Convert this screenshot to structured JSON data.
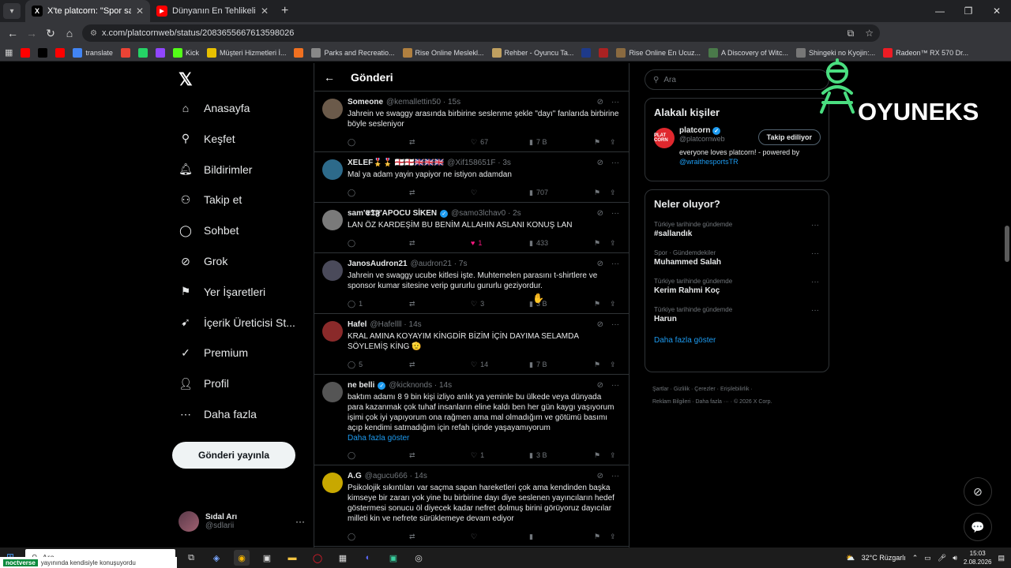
{
  "browser": {
    "tabs": [
      {
        "title": "X'te platcorn: \"Spor salonunda",
        "favicon": "X",
        "active": true
      },
      {
        "title": "Dünyanın En Tehlikeli Deniz Ca",
        "favicon": "▶",
        "active": false
      }
    ],
    "url": "x.com/platcornweb/status/2083655667613598026",
    "bookmarks": [
      {
        "label": "",
        "icon": "youtube-icon",
        "color": "#ff0000"
      },
      {
        "label": "",
        "icon": "x-icon",
        "color": "#000000"
      },
      {
        "label": "",
        "icon": "youtube-icon",
        "color": "#ff0000"
      },
      {
        "label": "translate",
        "icon": "google-icon",
        "color": "#4285f4"
      },
      {
        "label": "",
        "icon": "gmail-icon",
        "color": "#ea4335"
      },
      {
        "label": "",
        "icon": "whatsapp-icon",
        "color": "#25d366"
      },
      {
        "label": "",
        "icon": "twitch-icon",
        "color": "#9146ff"
      },
      {
        "label": "Kick",
        "icon": "kick-icon",
        "color": "#53fc18"
      },
      {
        "label": "Müşteri Hizmetleri İ...",
        "icon": "s-icon",
        "color": "#e8c000"
      },
      {
        "label": "",
        "icon": "k-icon",
        "color": "#f07020"
      },
      {
        "label": "Parks and Recreatio...",
        "icon": "bookmark-icon",
        "color": "#888888"
      },
      {
        "label": "Rise Online Meslekl...",
        "icon": "rise-icon",
        "color": "#b08040"
      },
      {
        "label": "Rehber - Oyuncu Ta...",
        "icon": "r-icon",
        "color": "#c0a060"
      },
      {
        "label": "",
        "icon": "b-icon",
        "color": "#1e3a8a"
      },
      {
        "label": "",
        "icon": "bookmark-icon",
        "color": "#aa2222"
      },
      {
        "label": "Rise Online En Ucuz...",
        "icon": "rise-icon",
        "color": "#8a6a40"
      },
      {
        "label": "A Discovery of Witc...",
        "icon": "witch-icon",
        "color": "#4a7a4a"
      },
      {
        "label": "Shingeki no Kyojin:...",
        "icon": "snk-icon",
        "color": "#777777"
      },
      {
        "label": "Radeon™ RX 570 Dr...",
        "icon": "radeon-icon",
        "color": "#ed1c24"
      }
    ]
  },
  "nav": {
    "items": [
      {
        "label": "Anasayfa",
        "icon": "home-icon",
        "name": "home"
      },
      {
        "label": "Keşfet",
        "icon": "search-icon",
        "name": "explore"
      },
      {
        "label": "Bildirimler",
        "icon": "bell-icon",
        "name": "notifications"
      },
      {
        "label": "Takip et",
        "icon": "add-person-icon",
        "name": "follow"
      },
      {
        "label": "Sohbet",
        "icon": "chat-icon",
        "name": "chat"
      },
      {
        "label": "Grok",
        "icon": "grok-icon",
        "name": "grok"
      },
      {
        "label": "Yer İşaretleri",
        "icon": "bookmark-icon",
        "name": "bookmarks"
      },
      {
        "label": "İçerik Üreticisi St...",
        "icon": "rocket-icon",
        "name": "creator-studio"
      },
      {
        "label": "Premium",
        "icon": "check-badge-icon",
        "name": "premium"
      },
      {
        "label": "Profil",
        "icon": "person-icon",
        "name": "profile"
      },
      {
        "label": "Daha fazla",
        "icon": "more-circle-icon",
        "name": "more"
      }
    ],
    "post_button": "Gönderi yayınla",
    "user": {
      "name": "Sıdal Arı",
      "handle": "@sdlarii"
    }
  },
  "feed": {
    "title": "Gönderi",
    "tweets": [
      {
        "name": "Someone",
        "handle": "@kemallettin50 · 15s",
        "verified": false,
        "text": "Jahrein ve swaggy arasında birbirine seslenme şekle \"dayı\" fanlarıda birbirine böyle sesleniyor",
        "more": "",
        "replies": "",
        "retweets": "",
        "likes": "67",
        "views": "7 B",
        "liked": false,
        "avatar": "#6b5a4a"
      },
      {
        "name": "XELEF🎖️🎖️ 🏴󠁧󠁢󠁥󠁮󠁧󠁿🏴󠁧󠁢󠁥󠁮󠁧󠁿🇬🇧🇬🇧🇬🇧",
        "handle": "@Xif158651F · 3s",
        "verified": false,
        "text": "Mal ya adam yayin yapiyor ne istiyon adamdan",
        "more": "",
        "replies": "",
        "retweets": "",
        "likes": "",
        "views": "707",
        "liked": false,
        "avatar": "#2d6a8a"
      },
      {
        "name": "sam'𝕰𝕿𝕱'APOCU SİKEN",
        "handle": "@samo3lchav0 · 2s",
        "verified": true,
        "text": "LAN ÖZ KARDEŞİM BU BENİM ALLAHIN ASLANI KONUŞ LAN",
        "more": "",
        "replies": "",
        "retweets": "",
        "likes": "1",
        "views": "433",
        "liked": true,
        "avatar": "#7a7a7a"
      },
      {
        "name": "JanosAudron21",
        "handle": "@audron21 · 7s",
        "verified": false,
        "text": "Jahrein ve swaggy ucube kitlesi işte. Muhtemelen  parasını t-shirtlere ve sponsor kumar sitesine verip gururlu gururlu geziyordur.",
        "more": "",
        "replies": "1",
        "retweets": "",
        "likes": "3",
        "views": "3 B",
        "liked": false,
        "avatar": "#4a4a5a"
      },
      {
        "name": "Hafel",
        "handle": "@Hafellll · 14s",
        "verified": false,
        "text": "KRAL AMINA KOYAYIM KİNGDİR BİZİM İÇİN DAYIMA SELAMDA SÖYLEMİŞ KİNG 🫡",
        "more": "",
        "replies": "5",
        "retweets": "",
        "likes": "14",
        "views": "7 B",
        "liked": false,
        "avatar": "#8a2a2a"
      },
      {
        "name": "ne belli",
        "handle": "@kicknonds · 14s",
        "verified": true,
        "text": "baktım adamı 8 9 bin kişi izliyo anlık ya yeminle bu ülkede veya dünyada para kazanmak çok tuhaf insanların eline kaldı ben her gün kaygı yaşıyorum işimi çok iyi yapıyorum ona rağmen ama mal olmadığım ve götümü basımı açıp kendimi satmadığım için refah içinde yaşayamıyorum",
        "more": "Daha fazla göster",
        "replies": "",
        "retweets": "",
        "likes": "1",
        "views": "3 B",
        "liked": false,
        "avatar": "#555555"
      },
      {
        "name": "A.G",
        "handle": "@agucu666 · 14s",
        "verified": false,
        "text": "Psikolojik sıkıntıları var saçma sapan hareketleri çok ama kendinden başka kimseye bir zararı yok yine bu birbirine dayı diye seslenen yayıncıların hedef göstermesi sonucu öl diyecek kadar nefret dolmuş birini görüyoruz dayıcılar milleti kin ve nefrete sürüklemeye devam ediyor",
        "more": "",
        "replies": "",
        "retweets": "",
        "likes": "",
        "views": "",
        "liked": false,
        "avatar": "#c8a800"
      }
    ]
  },
  "right": {
    "search_placeholder": "Ara",
    "related_title": "Alakalı kişiler",
    "related": {
      "name": "platcorn",
      "handle": "@platcornweb",
      "follow_label": "Takip ediliyor",
      "bio": "everyone loves platcorn! - powered by ",
      "bio_link": "@wraithesportsTR",
      "avatar_text": "PLAT CORN"
    },
    "trends_title": "Neler oluyor?",
    "trends": [
      {
        "context": "Türkiye tarihinde gündemde",
        "title": "#salla‌ndık"
      },
      {
        "context": "Spor · Gündemdekiler",
        "title": "Muhammed Salah"
      },
      {
        "context": "Türkiye tarihinde gündemde",
        "title": "Kerim Rahmi Koç"
      },
      {
        "context": "Türkiye tarihinde gündemde",
        "title": "Harun"
      }
    ],
    "show_more": "Daha fazla göster",
    "footer_line1": "Şartlar  ·  Gizlilik  ·  Çerezler  ·  Erişilebilirlik  ·",
    "footer_line2": "Reklam Bilgileri  ·  Daha fazla ···  ·  © 2026 X Corp."
  },
  "watermark": {
    "text": "OYUNEKS"
  },
  "taskbar": {
    "search_placeholder": "Ara",
    "weather": "32°C  Rüzgarlı",
    "time": "15:03",
    "date": "2.08.2026",
    "ticker_tag": "noctverse",
    "ticker_text": "yayınında kendisiyle konuşuyordu"
  }
}
